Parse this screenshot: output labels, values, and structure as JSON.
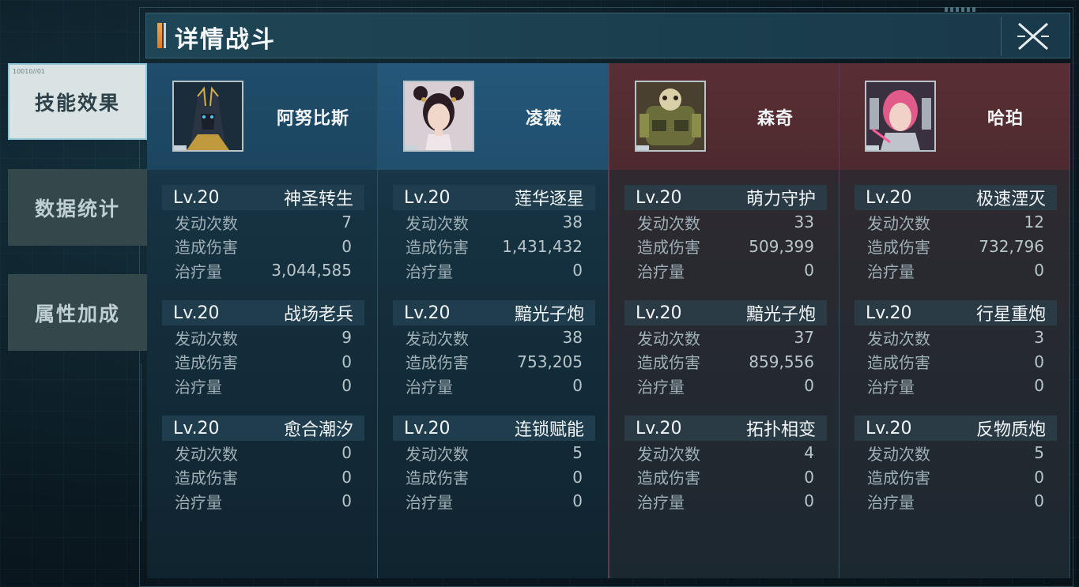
{
  "header": {
    "title": "详情战斗"
  },
  "tabs": [
    {
      "label": "技能效果",
      "tag": "10010//01",
      "active": true
    },
    {
      "label": "数据统计",
      "active": false
    },
    {
      "label": "属性加成",
      "active": false
    }
  ],
  "heroes": [
    {
      "name": "阿努比斯",
      "team": "blue",
      "skills": [
        {
          "level": "Lv.20",
          "name": "神圣转生",
          "stats": [
            [
              "发动次数",
              "7"
            ],
            [
              "造成伤害",
              "0"
            ],
            [
              "治疗量",
              "3,044,585"
            ]
          ]
        },
        {
          "level": "Lv.20",
          "name": "战场老兵",
          "stats": [
            [
              "发动次数",
              "9"
            ],
            [
              "造成伤害",
              "0"
            ],
            [
              "治疗量",
              "0"
            ]
          ]
        },
        {
          "level": "Lv.20",
          "name": "愈合潮汐",
          "stats": [
            [
              "发动次数",
              "0"
            ],
            [
              "造成伤害",
              "0"
            ],
            [
              "治疗量",
              "0"
            ]
          ]
        }
      ]
    },
    {
      "name": "凌薇",
      "team": "blue",
      "skills": [
        {
          "level": "Lv.20",
          "name": "莲华逐星",
          "stats": [
            [
              "发动次数",
              "38"
            ],
            [
              "造成伤害",
              "1,431,432"
            ],
            [
              "治疗量",
              "0"
            ]
          ]
        },
        {
          "level": "Lv.20",
          "name": "黯光子炮",
          "stats": [
            [
              "发动次数",
              "38"
            ],
            [
              "造成伤害",
              "753,205"
            ],
            [
              "治疗量",
              "0"
            ]
          ]
        },
        {
          "level": "Lv.20",
          "name": "连锁赋能",
          "stats": [
            [
              "发动次数",
              "5"
            ],
            [
              "造成伤害",
              "0"
            ],
            [
              "治疗量",
              "0"
            ]
          ]
        }
      ]
    },
    {
      "name": "森奇",
      "team": "red",
      "skills": [
        {
          "level": "Lv.20",
          "name": "萌力守护",
          "stats": [
            [
              "发动次数",
              "33"
            ],
            [
              "造成伤害",
              "509,399"
            ],
            [
              "治疗量",
              "0"
            ]
          ]
        },
        {
          "level": "Lv.20",
          "name": "黯光子炮",
          "stats": [
            [
              "发动次数",
              "37"
            ],
            [
              "造成伤害",
              "859,556"
            ],
            [
              "治疗量",
              "0"
            ]
          ]
        },
        {
          "level": "Lv.20",
          "name": "拓扑相变",
          "stats": [
            [
              "发动次数",
              "4"
            ],
            [
              "造成伤害",
              "0"
            ],
            [
              "治疗量",
              "0"
            ]
          ]
        }
      ]
    },
    {
      "name": "哈珀",
      "team": "red",
      "skills": [
        {
          "level": "Lv.20",
          "name": "极速湮灭",
          "stats": [
            [
              "发动次数",
              "12"
            ],
            [
              "造成伤害",
              "732,796"
            ],
            [
              "治疗量",
              "0"
            ]
          ]
        },
        {
          "level": "Lv.20",
          "name": "行星重炮",
          "stats": [
            [
              "发动次数",
              "3"
            ],
            [
              "造成伤害",
              "0"
            ],
            [
              "治疗量",
              "0"
            ]
          ]
        },
        {
          "level": "Lv.20",
          "name": "反物质炮",
          "stats": [
            [
              "发动次数",
              "5"
            ],
            [
              "造成伤害",
              "0"
            ],
            [
              "治疗量",
              "0"
            ]
          ]
        }
      ]
    }
  ]
}
